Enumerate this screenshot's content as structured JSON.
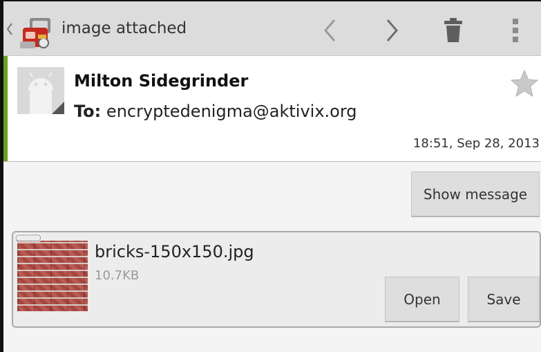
{
  "actionbar": {
    "title": "image attached",
    "icons": {
      "up": "up-caret-icon",
      "app": "app-icon",
      "prev": "chevron-left-icon",
      "next": "chevron-right-icon",
      "delete": "trash-icon",
      "overflow": "overflow-menu-icon"
    }
  },
  "message": {
    "sender": "Milton Sidegrinder",
    "to_label": "To:",
    "to_address": "encryptedenigma@aktivix.org",
    "datetime": "18:51, Sep 28, 2013",
    "show_message_label": "Show message",
    "accent_color": "#6aa121"
  },
  "attachment": {
    "filename": "bricks-150x150.jpg",
    "size": "10.7KB",
    "open_label": "Open",
    "save_label": "Save"
  }
}
